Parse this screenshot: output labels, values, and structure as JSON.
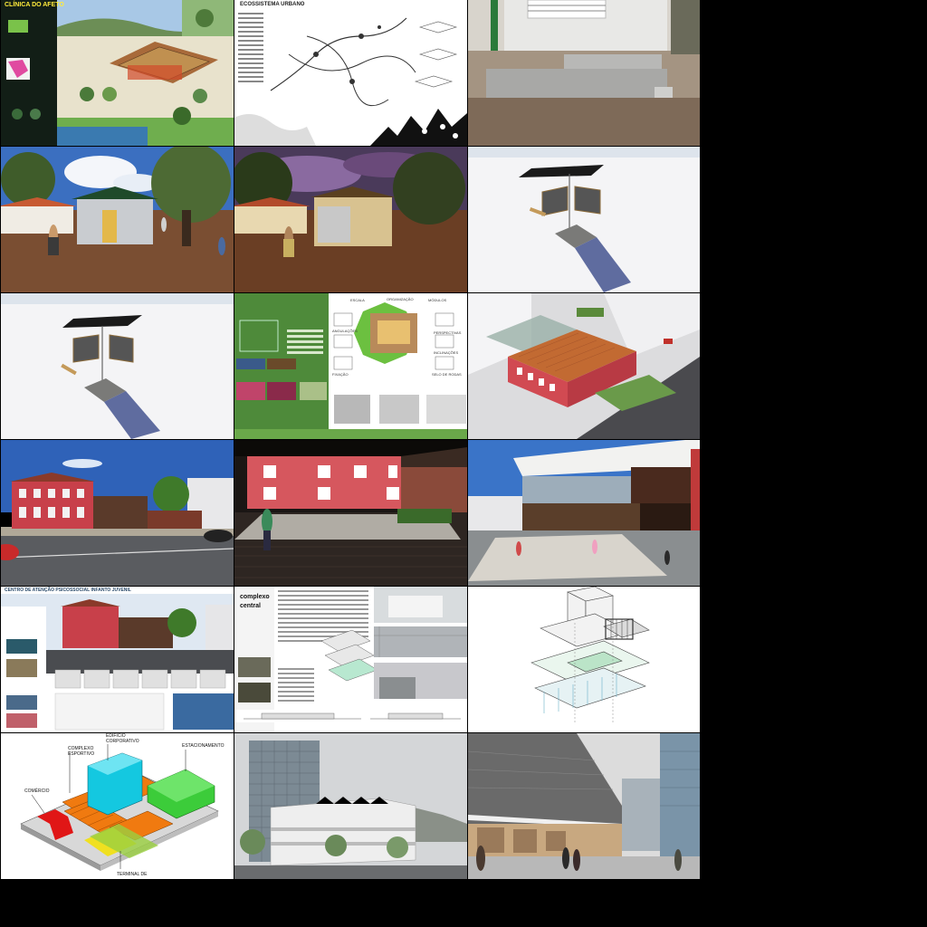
{
  "panels": {
    "p1": {
      "title": "CLÍNICA DO AFETO"
    },
    "p2": {
      "title": "ECOSSISTEMA URBANO"
    },
    "p8": {
      "labels": [
        "ESCALA",
        "ORGANIZAÇÃO",
        "MÓDULOS",
        "ANGULAÇÕES",
        "PERSPECTIVAS",
        "INCLINAÇÕES",
        "FIXAÇÃO",
        "SELO DE RODAS"
      ]
    },
    "p13": {
      "title": "CENTRO DE ATENÇÃO PSICOSSOCIAL INFANTO JUVENIL"
    },
    "p14": {
      "title_line1": "complexo",
      "title_line2": "central"
    },
    "p16": {
      "labels": {
        "corporativo": "EDIFÍCIO CORPORATIVO",
        "esportivo": "COMPLEXO ESPORTIVO",
        "estacionamento": "ESTACIONAMENTO",
        "comercio": "COMÉRCIO",
        "terminal": "TERMINAL DE"
      }
    }
  },
  "colors": {
    "background": "#000000",
    "green_panel": "#4e8a3a",
    "brick_red": "#c44a4a",
    "sky_blue": "#3f6fb5",
    "dirt": "#8a5a3a",
    "diagram_orange": "#f07a10",
    "diagram_cyan": "#14c8e0",
    "diagram_green": "#3ccc3a",
    "diagram_red": "#e01616",
    "diagram_yellow": "#f0e020"
  }
}
